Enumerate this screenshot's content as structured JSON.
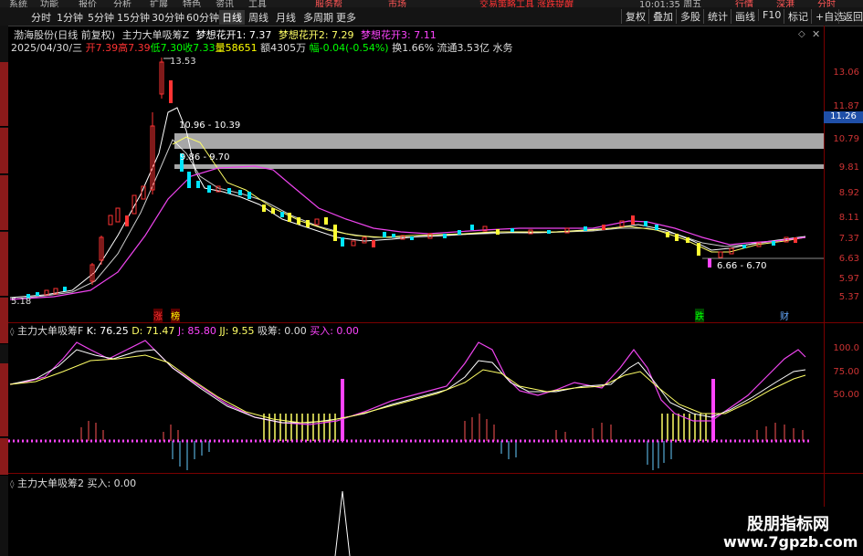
{
  "top_menu": {
    "items": [
      "系统",
      "功能",
      "报价",
      "分析",
      "扩展",
      "特色",
      "资讯",
      "工具",
      "服务帮",
      "市场"
    ],
    "marquee": "交易策略工具 涨跌提醒",
    "time": "10:01:35 周五",
    "right_items": [
      "行情",
      "深港",
      "分时"
    ]
  },
  "period_bar": {
    "items": [
      "分时",
      "1分钟",
      "5分钟",
      "15分钟",
      "30分钟",
      "60分钟",
      "日线",
      "周线",
      "月线",
      "多周期",
      "更多"
    ],
    "active": "日线",
    "right_buttons": [
      "复权",
      "叠加",
      "多股",
      "统计",
      "画线",
      "F10",
      "标记",
      "+自选",
      "返回"
    ]
  },
  "main_pane": {
    "title": "渤海股份(日线 前复权)",
    "indicator_line": "主力大单吸筹Z  梦想花开1: 7.37  梦想花开2: 7.29  梦想花开3: 7.11",
    "ind_name": "主力大单吸筹Z",
    "mh1": "梦想花开1: 7.37",
    "mh2": "梦想花开2: 7.29",
    "mh3": "梦想花开3: 7.11",
    "date": "2025/04/30/三",
    "open": "开7.39",
    "high": "高7.39",
    "low": "低7.30",
    "close": "收7.33",
    "volume": "量58651",
    "amount": "额4305万",
    "change": "幅-0.04(-0.54%)",
    "turnover": "换1.66%",
    "float": "流通3.53亿",
    "industry": "水务",
    "y_ticks": [
      "13.06",
      "11.87",
      "10.79",
      "9.81",
      "8.92",
      "8.11",
      "7.37",
      "6.63",
      "5.97",
      "5.37"
    ],
    "current_price": "11.26",
    "price_high_label": "13.53",
    "price_low_label": "5.18",
    "zone1": "10.96 - 10.39",
    "zone2": "9.86 - 9.70",
    "zone3": "6.66 - 6.70",
    "tags": [
      "涨",
      "榜",
      "跌",
      "财"
    ]
  },
  "sub_pane1": {
    "title": "主力大单吸筹F",
    "k": "K: 76.25",
    "d": "D: 71.47",
    "j": "J: 85.80",
    "jj": "JJ: 9.55",
    "xc": "吸筹: 0.00",
    "buy": "买入: 0.00",
    "y_ticks": [
      "100.0",
      "75.00",
      "50.00"
    ]
  },
  "sub_pane2": {
    "title": "主力大单吸筹2",
    "buy": "买入: 0.00"
  },
  "watermark": {
    "title": "股朋指标网",
    "url": "www.7gpzb.com"
  },
  "colors": {
    "up": "#ff3333",
    "down": "#00ffff",
    "yellow": "#ffff66",
    "magenta": "#ff44ff",
    "white": "#ffffff"
  }
}
